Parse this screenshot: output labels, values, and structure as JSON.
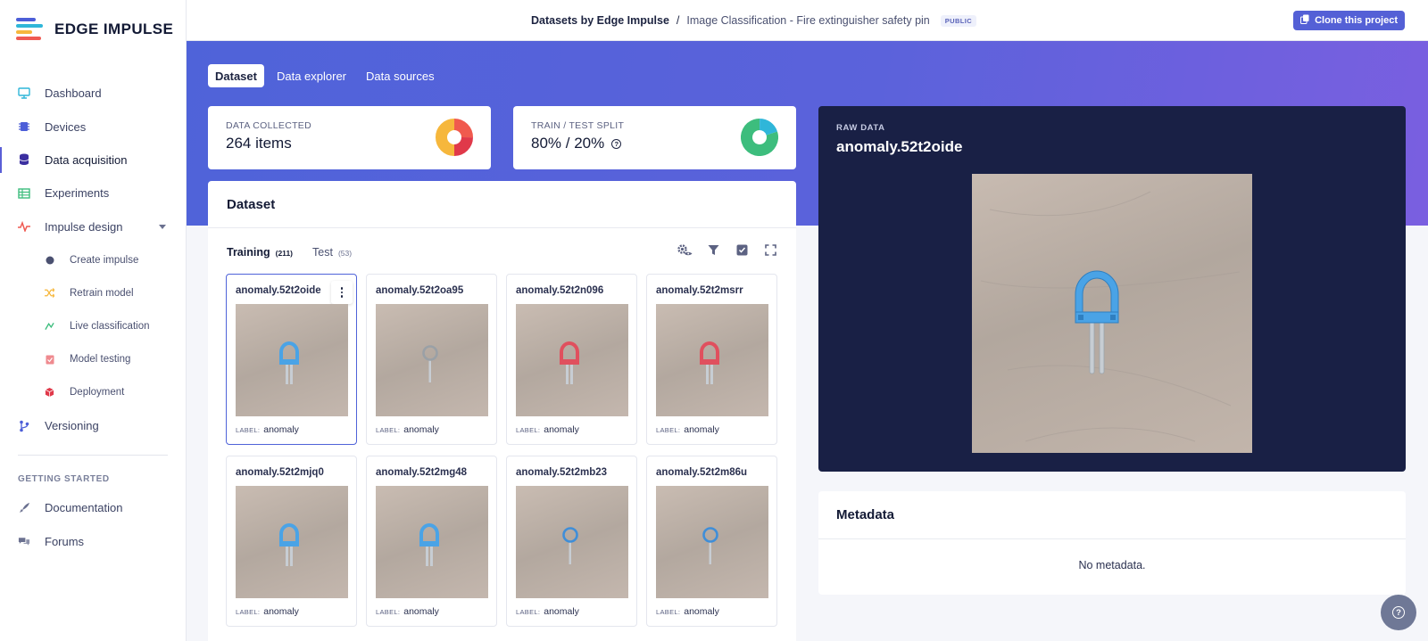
{
  "brand": {
    "name": "EDGE IMPULSE"
  },
  "sidebar": {
    "items": [
      {
        "label": "Dashboard",
        "icon": "monitor-icon"
      },
      {
        "label": "Devices",
        "icon": "chip-icon"
      },
      {
        "label": "Data acquisition",
        "icon": "database-icon",
        "active": true
      },
      {
        "label": "Experiments",
        "icon": "table-icon"
      },
      {
        "label": "Impulse design",
        "icon": "pulse-icon"
      }
    ],
    "subitems": [
      {
        "label": "Create impulse",
        "icon": "dot-icon"
      },
      {
        "label": "Retrain model",
        "icon": "shuffle-icon"
      },
      {
        "label": "Live classification",
        "icon": "broadcast-icon"
      },
      {
        "label": "Model testing",
        "icon": "clipboard-check-icon"
      },
      {
        "label": "Deployment",
        "icon": "cube-icon"
      }
    ],
    "versioning": {
      "label": "Versioning",
      "icon": "branch-icon"
    },
    "section_label": "GETTING STARTED",
    "help_items": [
      {
        "label": "Documentation",
        "icon": "rocket-icon"
      },
      {
        "label": "Forums",
        "icon": "chat-icon"
      }
    ]
  },
  "topbar": {
    "owner": "Datasets by Edge Impulse",
    "separator": "/",
    "project": "Image Classification - Fire extinguisher safety pin",
    "badge": "PUBLIC",
    "clone_label": "Clone this project"
  },
  "tabs": [
    {
      "label": "Dataset",
      "active": true
    },
    {
      "label": "Data explorer"
    },
    {
      "label": "Data sources"
    }
  ],
  "stats": {
    "collected": {
      "label": "DATA COLLECTED",
      "value": "264 items"
    },
    "split": {
      "label": "TRAIN / TEST SPLIT",
      "value": "80% / 20%"
    }
  },
  "dataset": {
    "title": "Dataset",
    "subtabs": [
      {
        "label": "Training",
        "count": "(211)",
        "active": true
      },
      {
        "label": "Test",
        "count": "(53)"
      }
    ],
    "label_key": "LABEL:",
    "samples": [
      {
        "name": "anomaly.52t2oide",
        "label": "anomaly",
        "pin_color": "#4aa3e6",
        "pin_shape": "loop"
      },
      {
        "name": "anomaly.52t2oa95",
        "label": "anomaly",
        "pin_color": "#9aa0a6",
        "pin_shape": "ring"
      },
      {
        "name": "anomaly.52t2n096",
        "label": "anomaly",
        "pin_color": "#e0505e",
        "pin_shape": "loop"
      },
      {
        "name": "anomaly.52t2msrr",
        "label": "anomaly",
        "pin_color": "#e0505e",
        "pin_shape": "loop"
      },
      {
        "name": "anomaly.52t2mjq0",
        "label": "anomaly",
        "pin_color": "#4aa3e6",
        "pin_shape": "loop"
      },
      {
        "name": "anomaly.52t2mg48",
        "label": "anomaly",
        "pin_color": "#4aa3e6",
        "pin_shape": "loop"
      },
      {
        "name": "anomaly.52t2mb23",
        "label": "anomaly",
        "pin_color": "#3f8ed8",
        "pin_shape": "ring"
      },
      {
        "name": "anomaly.52t2m86u",
        "label": "anomaly",
        "pin_color": "#3f8ed8",
        "pin_shape": "ring"
      }
    ]
  },
  "raw_data": {
    "label": "RAW DATA",
    "title": "anomaly.52t2oide"
  },
  "metadata": {
    "title": "Metadata",
    "empty": "No metadata."
  },
  "colors": {
    "accent": "#5460d6",
    "dark_panel": "#192045"
  }
}
